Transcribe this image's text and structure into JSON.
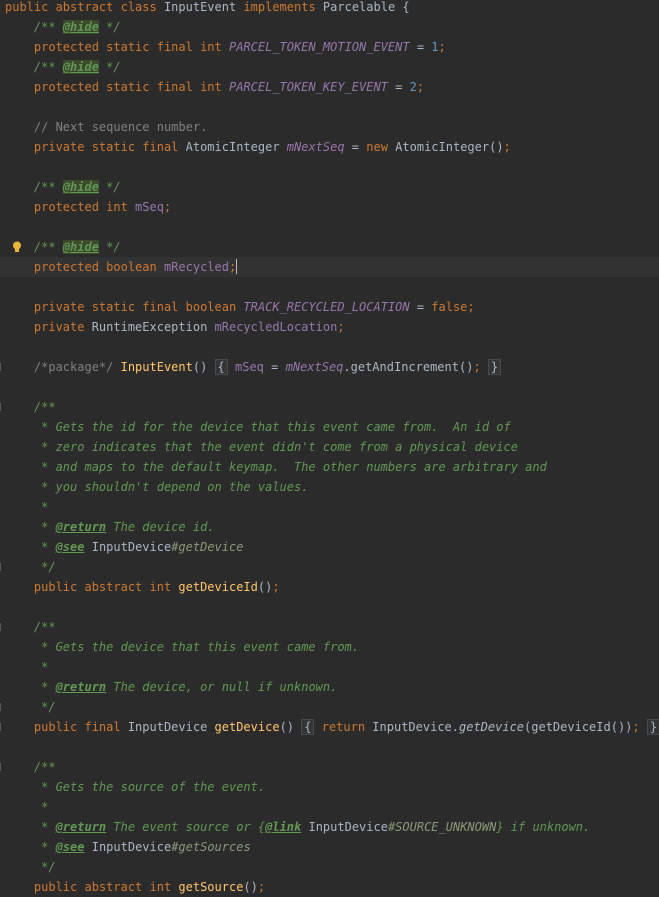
{
  "editor": {
    "lines": [
      {
        "tokens": [
          {
            "t": "public abstract class ",
            "c": "kw"
          },
          {
            "t": "InputEvent ",
            "c": "id"
          },
          {
            "t": "implements ",
            "c": "kw"
          },
          {
            "t": "Parcelable {",
            "c": "id"
          }
        ]
      },
      {
        "tokens": [
          {
            "t": "    /** ",
            "c": "doc"
          },
          {
            "t": "@hide",
            "c": "tagbg"
          },
          {
            "t": " */",
            "c": "doc"
          }
        ]
      },
      {
        "tokens": [
          {
            "t": "    protected static final int ",
            "c": "kw"
          },
          {
            "t": "PARCEL_TOKEN_MOTION_EVENT",
            "c": "cst"
          },
          {
            "t": " = ",
            "c": "id"
          },
          {
            "t": "1",
            "c": "num"
          },
          {
            "t": ";",
            "c": "kw"
          }
        ]
      },
      {
        "tokens": [
          {
            "t": "    /** ",
            "c": "doc"
          },
          {
            "t": "@hide",
            "c": "tagbg"
          },
          {
            "t": " */",
            "c": "doc"
          }
        ]
      },
      {
        "tokens": [
          {
            "t": "    protected static final int ",
            "c": "kw"
          },
          {
            "t": "PARCEL_TOKEN_KEY_EVENT",
            "c": "cst"
          },
          {
            "t": " = ",
            "c": "id"
          },
          {
            "t": "2",
            "c": "num"
          },
          {
            "t": ";",
            "c": "kw"
          }
        ]
      },
      {
        "tokens": []
      },
      {
        "tokens": [
          {
            "t": "    // Next sequence number.",
            "c": "cm"
          }
        ]
      },
      {
        "tokens": [
          {
            "t": "    private static final ",
            "c": "kw"
          },
          {
            "t": "AtomicInteger ",
            "c": "id"
          },
          {
            "t": "mNextSeq",
            "c": "cst"
          },
          {
            "t": " = ",
            "c": "id"
          },
          {
            "t": "new ",
            "c": "kw"
          },
          {
            "t": "AtomicInteger()",
            "c": "id"
          },
          {
            "t": ";",
            "c": "kw"
          }
        ]
      },
      {
        "tokens": []
      },
      {
        "tokens": [
          {
            "t": "    /** ",
            "c": "doc"
          },
          {
            "t": "@hide",
            "c": "tagbg"
          },
          {
            "t": " */",
            "c": "doc"
          }
        ]
      },
      {
        "tokens": [
          {
            "t": "    protected int ",
            "c": "kw"
          },
          {
            "t": "mSeq",
            "c": "fld"
          },
          {
            "t": ";",
            "c": "kw"
          }
        ]
      },
      {
        "tokens": []
      },
      {
        "bulb": true,
        "tokens": [
          {
            "t": "    /** ",
            "c": "doc"
          },
          {
            "t": "@hide",
            "c": "tagbg"
          },
          {
            "t": " */",
            "c": "doc"
          }
        ]
      },
      {
        "current": true,
        "caret": true,
        "tokens": [
          {
            "t": "    protected boolean ",
            "c": "kw"
          },
          {
            "t": "mRecycled",
            "c": "fld"
          },
          {
            "t": ";",
            "c": "kw"
          }
        ]
      },
      {
        "tokens": []
      },
      {
        "tokens": [
          {
            "t": "    private static final boolean ",
            "c": "kw"
          },
          {
            "t": "TRACK_RECYCLED_LOCATION",
            "c": "cst"
          },
          {
            "t": " = ",
            "c": "id"
          },
          {
            "t": "false",
            "c": "kw"
          },
          {
            "t": ";",
            "c": "kw"
          }
        ]
      },
      {
        "tokens": [
          {
            "t": "    private ",
            "c": "kw"
          },
          {
            "t": "RuntimeException ",
            "c": "id"
          },
          {
            "t": "mRecycledLocation",
            "c": "fld"
          },
          {
            "t": ";",
            "c": "kw"
          }
        ]
      },
      {
        "tokens": []
      },
      {
        "gutter": true,
        "tokens": [
          {
            "t": "    /*package*/ ",
            "c": "cm"
          },
          {
            "t": "InputEvent",
            "c": "mth"
          },
          {
            "t": "() ",
            "c": "id"
          },
          {
            "t": "{",
            "c": "fold"
          },
          {
            "t": " ",
            "c": "id"
          },
          {
            "t": "mSeq",
            "c": "fld"
          },
          {
            "t": " = ",
            "c": "id"
          },
          {
            "t": "mNextSeq",
            "c": "cst"
          },
          {
            "t": ".getAndIncrement()",
            "c": "id"
          },
          {
            "t": ";",
            "c": "kw"
          },
          {
            "t": " ",
            "c": "id"
          },
          {
            "t": "}",
            "c": "fold"
          }
        ]
      },
      {
        "tokens": []
      },
      {
        "gutter": true,
        "tokens": [
          {
            "t": "    /**",
            "c": "doc"
          }
        ]
      },
      {
        "tokens": [
          {
            "t": "     * Gets the id for the device that this event came from.  An id of",
            "c": "doc"
          }
        ]
      },
      {
        "tokens": [
          {
            "t": "     * zero indicates that the event didn't come from a physical device",
            "c": "doc"
          }
        ]
      },
      {
        "tokens": [
          {
            "t": "     * and maps to the default keymap.  The other numbers are arbitrary and",
            "c": "doc"
          }
        ]
      },
      {
        "tokens": [
          {
            "t": "     * you shouldn't depend on the values.",
            "c": "doc"
          }
        ]
      },
      {
        "tokens": [
          {
            "t": "     *",
            "c": "doc"
          }
        ]
      },
      {
        "tokens": [
          {
            "t": "     * ",
            "c": "doc"
          },
          {
            "t": "@return",
            "c": "tag"
          },
          {
            "t": " The device id.",
            "c": "doc"
          }
        ]
      },
      {
        "tokens": [
          {
            "t": "     * ",
            "c": "doc"
          },
          {
            "t": "@see",
            "c": "tag"
          },
          {
            "t": " ",
            "c": "doc"
          },
          {
            "t": "InputDevice",
            "c": "id"
          },
          {
            "t": "#getDevice",
            "c": "ref"
          }
        ]
      },
      {
        "gutter": true,
        "tokens": [
          {
            "t": "     */",
            "c": "doc"
          }
        ]
      },
      {
        "tokens": [
          {
            "t": "    public abstract int ",
            "c": "kw"
          },
          {
            "t": "getDeviceId",
            "c": "mth"
          },
          {
            "t": "()",
            "c": "id"
          },
          {
            "t": ";",
            "c": "kw"
          }
        ]
      },
      {
        "tokens": []
      },
      {
        "gutter": true,
        "tokens": [
          {
            "t": "    /**",
            "c": "doc"
          }
        ]
      },
      {
        "tokens": [
          {
            "t": "     * Gets the device that this event came from.",
            "c": "doc"
          }
        ]
      },
      {
        "tokens": [
          {
            "t": "     *",
            "c": "doc"
          }
        ]
      },
      {
        "tokens": [
          {
            "t": "     * ",
            "c": "doc"
          },
          {
            "t": "@return",
            "c": "tag"
          },
          {
            "t": " The device, or null if unknown.",
            "c": "doc"
          }
        ]
      },
      {
        "gutter": true,
        "tokens": [
          {
            "t": "     */",
            "c": "doc"
          }
        ]
      },
      {
        "gutter": true,
        "tokens": [
          {
            "t": "    public final ",
            "c": "kw"
          },
          {
            "t": "InputDevice ",
            "c": "id"
          },
          {
            "t": "getDevice",
            "c": "mth"
          },
          {
            "t": "() ",
            "c": "id"
          },
          {
            "t": "{",
            "c": "fold"
          },
          {
            "t": " ",
            "c": "id"
          },
          {
            "t": "return ",
            "c": "kw"
          },
          {
            "t": "InputDevice.",
            "c": "id"
          },
          {
            "t": "getDevice",
            "c": "smth"
          },
          {
            "t": "(getDeviceId())",
            "c": "id"
          },
          {
            "t": ";",
            "c": "kw"
          },
          {
            "t": " ",
            "c": "id"
          },
          {
            "t": "}",
            "c": "fold"
          }
        ]
      },
      {
        "tokens": []
      },
      {
        "gutter": true,
        "tokens": [
          {
            "t": "    /**",
            "c": "doc"
          }
        ]
      },
      {
        "tokens": [
          {
            "t": "     * Gets the source of the event.",
            "c": "doc"
          }
        ]
      },
      {
        "tokens": [
          {
            "t": "     *",
            "c": "doc"
          }
        ]
      },
      {
        "tokens": [
          {
            "t": "     * ",
            "c": "doc"
          },
          {
            "t": "@return",
            "c": "tag"
          },
          {
            "t": " The event source or {",
            "c": "doc"
          },
          {
            "t": "@link",
            "c": "tag"
          },
          {
            "t": " ",
            "c": "doc"
          },
          {
            "t": "InputDevice",
            "c": "id"
          },
          {
            "t": "#SOURCE_UNKNOWN",
            "c": "ref"
          },
          {
            "t": "} if unknown.",
            "c": "doc"
          }
        ]
      },
      {
        "tokens": [
          {
            "t": "     * ",
            "c": "doc"
          },
          {
            "t": "@see",
            "c": "tag"
          },
          {
            "t": " ",
            "c": "doc"
          },
          {
            "t": "InputDevice",
            "c": "id"
          },
          {
            "t": "#getSources",
            "c": "ref"
          }
        ]
      },
      {
        "tokens": [
          {
            "t": "     */",
            "c": "doc"
          }
        ]
      },
      {
        "tokens": [
          {
            "t": "    public abstract int ",
            "c": "kw"
          },
          {
            "t": "getSource",
            "c": "mth"
          },
          {
            "t": "()",
            "c": "id"
          },
          {
            "t": ";",
            "c": "kw"
          }
        ]
      }
    ]
  },
  "colors": {
    "background": "#2b2b2b",
    "current_line": "#323232",
    "keyword": "#cc7832",
    "javadoc": "#629755",
    "method": "#ffc66d",
    "field": "#9876aa",
    "number": "#6897bb",
    "comment": "#808080",
    "text": "#a9b7c6",
    "bulb": "#e8b43a"
  },
  "icons": {
    "intention": "lightbulb-icon",
    "fold": "fold-marker-icon"
  }
}
